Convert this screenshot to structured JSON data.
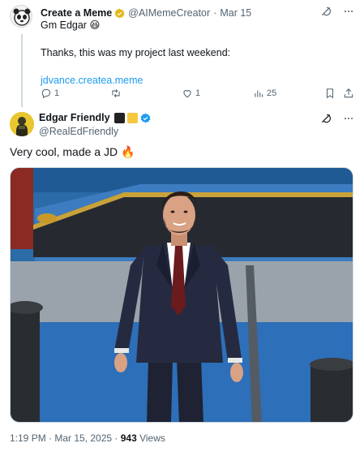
{
  "tweet1": {
    "name": "Create a Meme",
    "handle": "@AIMemeCreator",
    "sep": "·",
    "date": "Mar 15",
    "lines": [
      "Gm Edgar 😆",
      "Thanks, this was my project last weekend:"
    ],
    "link": "jdvance.createa.meme",
    "replies": "1",
    "retweets": "",
    "likes": "1",
    "views": "25"
  },
  "tweet2": {
    "name": "Edgar Friendly",
    "handle": "@RealEdFriendly",
    "text": "Very cool, made a JD 🔥",
    "time": "1:19 PM · Mar 15, 2025 · ",
    "views_count": "943",
    "views_label": " Views"
  },
  "icons": [
    "avatar-panda",
    "verified-badge",
    "grok-icon",
    "more-icon",
    "reply-icon",
    "retweet-icon",
    "like-icon",
    "views-icon",
    "bookmark-icon",
    "share-icon"
  ]
}
